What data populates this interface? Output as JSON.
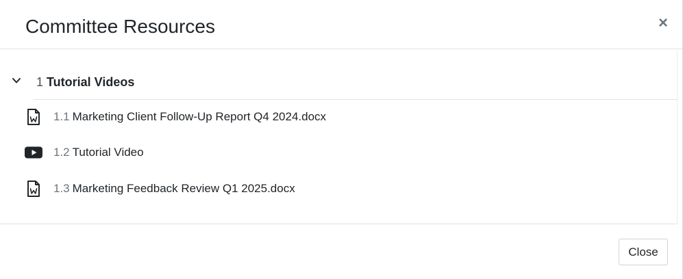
{
  "modal": {
    "title": "Committee Resources",
    "close_symbol": "×",
    "close_button_label": "Close"
  },
  "section": {
    "number": "1",
    "title": "Tutorial Videos",
    "chevron_icon": "chevron-down-icon",
    "items": [
      {
        "number": "1.1",
        "label": "Marketing Client Follow-Up Report Q4 2024.docx",
        "icon": "word-document-icon"
      },
      {
        "number": "1.2",
        "label": "Tutorial Video",
        "icon": "youtube-icon"
      },
      {
        "number": "1.3",
        "label": "Marketing Feedback Review Q1 2025.docx",
        "icon": "word-document-icon"
      }
    ]
  },
  "colors": {
    "text": "#212529",
    "muted": "#6c757d",
    "border": "#dee2e6",
    "icon": "#212529"
  }
}
